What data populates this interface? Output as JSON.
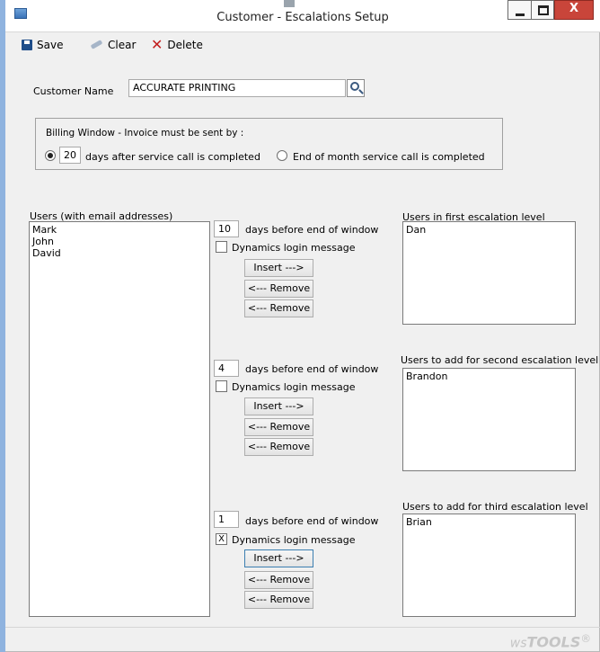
{
  "window": {
    "title": "Customer - Escalations Setup",
    "minimize_glyph": "–",
    "maximize_glyph": "□",
    "close_glyph": "X"
  },
  "toolbar": {
    "save_label": "Save",
    "clear_label": "Clear",
    "delete_label": "Delete"
  },
  "customer": {
    "label": "Customer Name",
    "value": "ACCURATE PRINTING"
  },
  "billing": {
    "group_label": "Billing Window - Invoice must be sent by :",
    "days_value": "20",
    "option_after_label": "days after service call is completed",
    "option_eom_label": "End of month service call is completed",
    "selected": "after"
  },
  "users": {
    "label": "Users (with email addresses)",
    "items": [
      "Mark",
      "John",
      "David"
    ]
  },
  "levels": [
    {
      "days": "10",
      "days_label": "days before end of window",
      "login_label": "Dynamics login message",
      "login_checked": "",
      "insert_label": "Insert --->",
      "remove_label_1": "<--- Remove",
      "remove_label_2": "<--- Remove",
      "list_label": "Users in first escalation level",
      "list_items": [
        "Dan"
      ]
    },
    {
      "days": "4",
      "days_label": "days before end of window",
      "login_label": "Dynamics login message",
      "login_checked": "",
      "insert_label": "Insert --->",
      "remove_label_1": "<--- Remove",
      "remove_label_2": "<--- Remove",
      "list_label": "Users to add for second escalation level",
      "list_items": [
        "Brandon"
      ]
    },
    {
      "days": "1",
      "days_label": "days before end of window",
      "login_label": "Dynamics login message",
      "login_checked": "X",
      "insert_label": "Insert --->",
      "remove_label_1": "<--- Remove",
      "remove_label_2": "<--- Remove",
      "list_label": "Users to add for third escalation level",
      "list_items": [
        "Brian"
      ]
    }
  ],
  "footer": {
    "brand_prefix": "ws",
    "brand_main": "TOOLS",
    "brand_mark": "®"
  },
  "icons": {
    "app": "app-window-icon",
    "save": "floppy-disk-icon",
    "clear": "eraser-icon",
    "delete": "red-x-icon",
    "lookup": "magnifier-icon"
  }
}
